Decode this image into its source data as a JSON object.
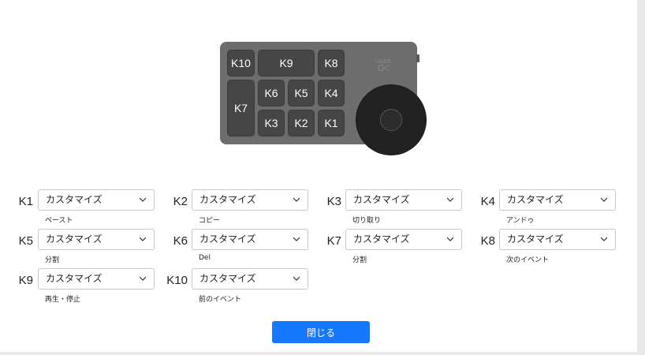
{
  "device": {
    "keys": {
      "k10": "K10",
      "k9": "K9",
      "k8": "K8",
      "k7": "K7",
      "k6": "K6",
      "k5": "K5",
      "k4": "K4",
      "k3": "K3",
      "k2": "K2",
      "k1": "K1"
    },
    "brand_top": "UGEE",
    "brand_mark": "ᗡᐸ"
  },
  "mappings": [
    {
      "key": "K1",
      "value": "カスタマイズ",
      "desc": "ペースト"
    },
    {
      "key": "K2",
      "value": "カスタマイズ",
      "desc": "コピー"
    },
    {
      "key": "K3",
      "value": "カスタマイズ",
      "desc": "切り取り"
    },
    {
      "key": "K4",
      "value": "カスタマイズ",
      "desc": "アンドゥ"
    },
    {
      "key": "K5",
      "value": "カスタマイズ",
      "desc": "分割"
    },
    {
      "key": "K6",
      "value": "カスタマイズ",
      "desc": "Del"
    },
    {
      "key": "K7",
      "value": "カスタマイズ",
      "desc": "分割"
    },
    {
      "key": "K8",
      "value": "カスタマイズ",
      "desc": "次のイベント"
    },
    {
      "key": "K9",
      "value": "カスタマイズ",
      "desc": "再生・停止"
    },
    {
      "key": "K10",
      "value": "カスタマイズ",
      "desc": "前のイベント"
    }
  ],
  "close_label": "閉じる",
  "colors": {
    "accent": "#1677ff",
    "device_body": "#6d6d6d",
    "key_cap": "#464646"
  }
}
